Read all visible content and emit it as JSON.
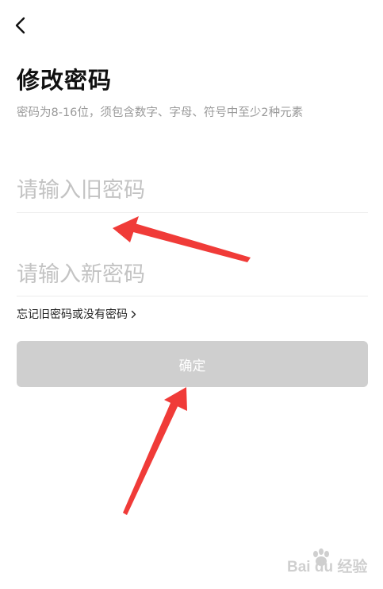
{
  "header": {
    "back_icon": "chevron-left-icon",
    "title": "修改密码",
    "subtitle": "密码为8-16位，须包含数字、字母、符号中至少2种元素"
  },
  "form": {
    "old_password_placeholder": "请输入旧密码",
    "new_password_placeholder": "请输入新密码",
    "forgot_link": "忘记旧密码或没有密码",
    "forgot_icon": "chevron-right-icon",
    "confirm_label": "确定"
  },
  "colors": {
    "button_disabled_bg": "#cfcfcf",
    "annotation_arrow": "#f03b38",
    "placeholder": "#c3c3c3",
    "subtitle": "#9a9a9a"
  },
  "watermark": {
    "text": "Bai du 经验"
  }
}
